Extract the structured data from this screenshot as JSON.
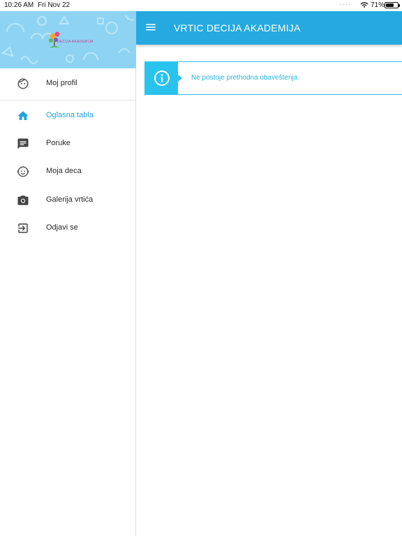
{
  "status_bar": {
    "time": "10:26 AM",
    "date": "Fri Nov 22",
    "battery_percent": "71%",
    "battery_level": 0.71,
    "icons": [
      "wifi-icon",
      "battery-icon"
    ]
  },
  "drawer": {
    "logo": {
      "text": "DECIJA AKADEMIJA"
    },
    "items": [
      {
        "label": "Moj profil",
        "icon": "face-icon",
        "active": false
      },
      {
        "label": "Oglasna tabla",
        "icon": "home-icon",
        "active": true
      },
      {
        "label": "Poruke",
        "icon": "message-icon",
        "active": false
      },
      {
        "label": "Moja deca",
        "icon": "baby-face-icon",
        "active": false
      },
      {
        "label": "Galerija vrtića",
        "icon": "camera-icon",
        "active": false
      },
      {
        "label": "Odjavi se",
        "icon": "logout-icon",
        "active": false
      }
    ]
  },
  "app_bar": {
    "title": "VRTIC DECIJA AKADEMIJA",
    "menu_icon": "hamburger-icon"
  },
  "notice": {
    "message": "Ne postoje prethodna obaveštenja.",
    "icon": "info-icon"
  },
  "colors": {
    "primary": "#26a9e0",
    "notice_accent": "#29c3ee",
    "active_nav": "#1ea4de",
    "header_bg": "#8ed4f2"
  }
}
